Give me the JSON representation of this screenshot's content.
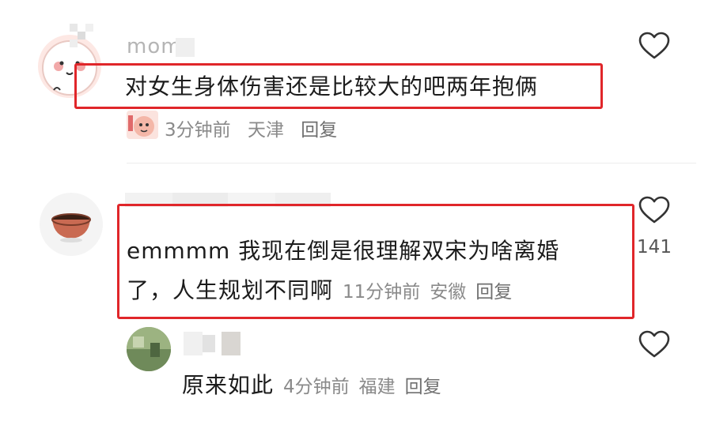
{
  "comments": [
    {
      "username": "mom",
      "text": "对女生身体伤害还是比较大的吧两年抱俩",
      "time": "3分钟前",
      "location": "天津",
      "reply_label": "回复"
    },
    {
      "text_line1": "emmmm 我现在倒是很理解双宋为啥离婚",
      "text_line2": "了，人生规划不同啊",
      "time": "11分钟前",
      "location": "安徽",
      "reply_label": "回复",
      "like_count": "141"
    },
    {
      "text": "原来如此",
      "time": "4分钟前",
      "location": "福建",
      "reply_label": "回复"
    }
  ],
  "colors": {
    "highlight": "#e0262a",
    "meta_text": "#8a8a8a",
    "main_text": "#1c1c1c"
  },
  "icons": {
    "like": "heart-outline-icon"
  }
}
